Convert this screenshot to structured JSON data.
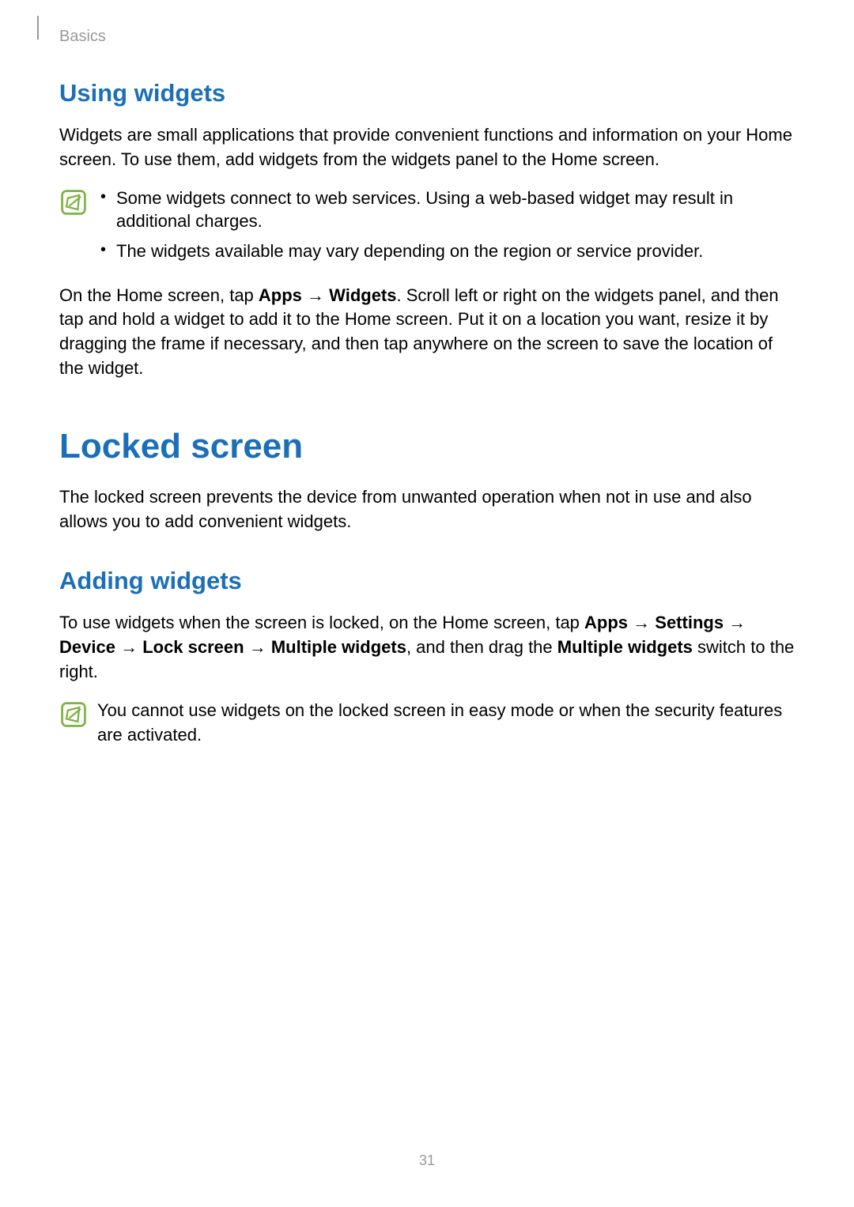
{
  "header": {
    "section_label": "Basics"
  },
  "section1": {
    "heading": "Using widgets",
    "intro": "Widgets are small applications that provide convenient functions and information on your Home screen. To use them, add widgets from the widgets panel to the Home screen.",
    "note_bullets": [
      "Some widgets connect to web services. Using a web-based widget may result in additional charges.",
      "The widgets available may vary depending on the region or service provider."
    ],
    "instructions": {
      "pre1": "On the Home screen, tap ",
      "bold1": "Apps",
      "arrow": " → ",
      "bold2": "Widgets",
      "post": ". Scroll left or right on the widgets panel, and then tap and hold a widget to add it to the Home screen. Put it on a location you want, resize it by dragging the frame if necessary, and then tap anywhere on the screen to save the location of the widget."
    }
  },
  "section2": {
    "heading": "Locked screen",
    "intro": "The locked screen prevents the device from unwanted operation when not in use and also allows you to add convenient widgets."
  },
  "section3": {
    "heading": "Adding widgets",
    "instructions": {
      "pre1": "To use widgets when the screen is locked, on the Home screen, tap ",
      "bold1": "Apps",
      "arrow1": " → ",
      "bold2": "Settings",
      "arrow2": " → ",
      "bold3": "Device",
      "arrow3": " → ",
      "bold4": "Lock screen",
      "arrow4": " → ",
      "bold5": "Multiple widgets",
      "mid": ", and then drag the ",
      "bold6": "Multiple widgets",
      "post": " switch to the right."
    },
    "note": "You cannot use widgets on the locked screen in easy mode or when the security features are activated."
  },
  "page_number": "31"
}
